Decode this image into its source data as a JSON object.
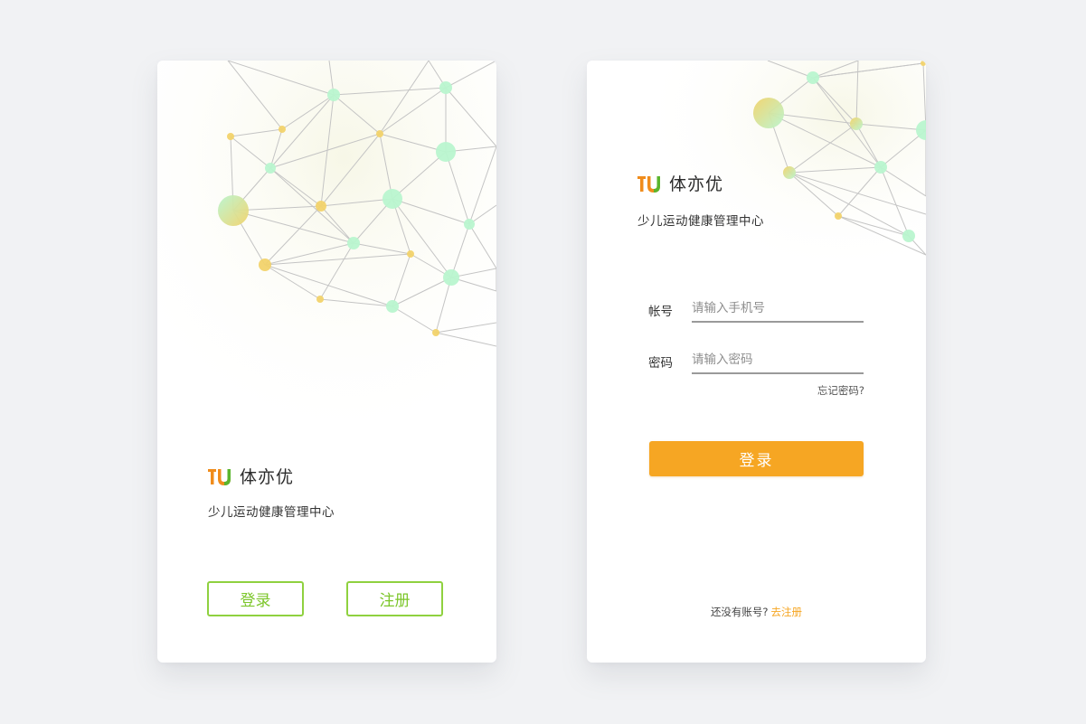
{
  "brand": {
    "name": "体亦优",
    "tagline": "少儿运动健康管理中心",
    "logo_icon": "tu-logo-icon",
    "logo_colors": {
      "primary": "#f08c1c",
      "secondary": "#5ab52d"
    }
  },
  "welcome": {
    "login_label": "登录",
    "register_label": "注册"
  },
  "login": {
    "account_label": "帐号",
    "account_placeholder": "请输入手机号",
    "password_label": "密码",
    "password_placeholder": "请输入密码",
    "forgot_label": "忘记密码?",
    "submit_label": "登录",
    "no_account_text": "还没有账号?",
    "register_link": "去注册"
  },
  "colors": {
    "accent_orange": "#f6a623",
    "accent_green": "#8fd13f",
    "background": "#f1f2f4"
  }
}
